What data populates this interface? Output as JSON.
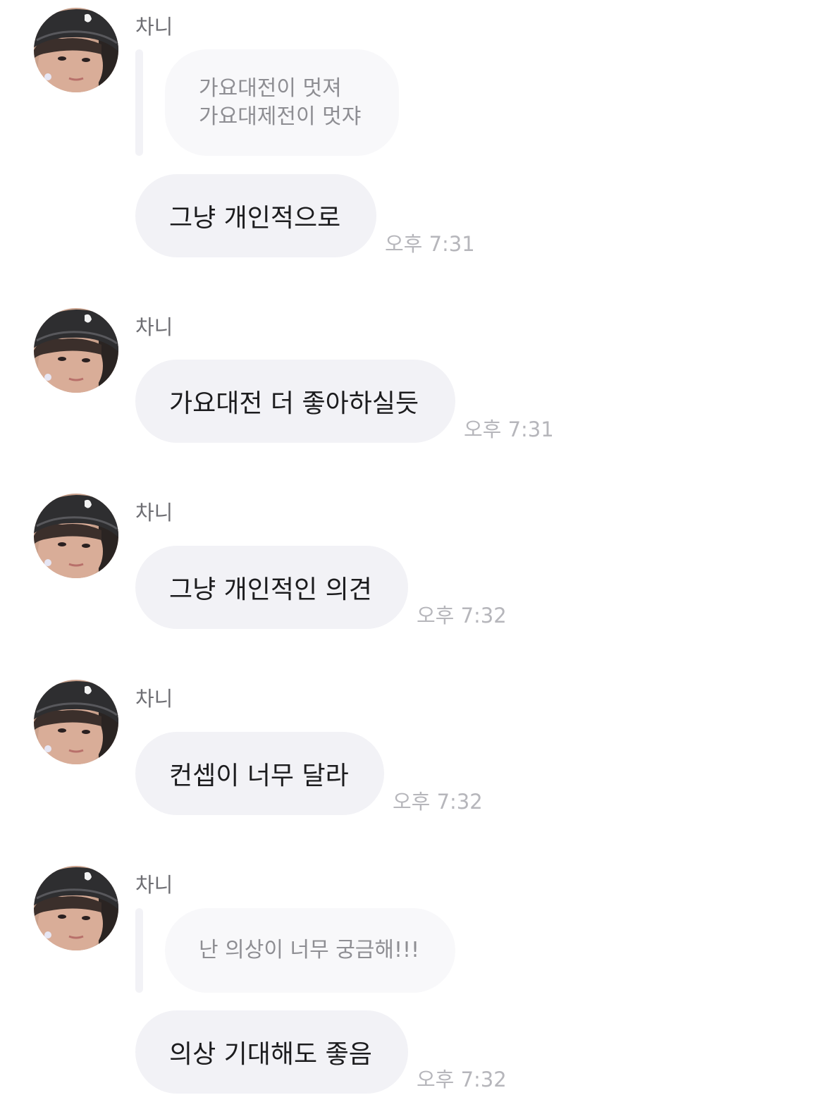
{
  "colors": {
    "bubble": "#f2f2f6",
    "reply_bubble": "#f8f8fa",
    "name_text": "#6e6e73",
    "time_text": "#b6b6bb"
  },
  "messages": [
    {
      "sender": "차니",
      "avatar_icon": "profile-photo-icon",
      "reply_quote": [
        "가요대전이 멋져",
        "가요대제전이 멋쟈"
      ],
      "text": "그냥 개인적으로",
      "time": "오후 7:31"
    },
    {
      "sender": "차니",
      "avatar_icon": "profile-photo-icon",
      "text": "가요대전 더 좋아하실듯",
      "time": "오후 7:31"
    },
    {
      "sender": "차니",
      "avatar_icon": "profile-photo-icon",
      "text": "그냥 개인적인 의견",
      "time": "오후 7:32"
    },
    {
      "sender": "차니",
      "avatar_icon": "profile-photo-icon",
      "text": "컨셉이 너무 달라",
      "time": "오후 7:32"
    },
    {
      "sender": "차니",
      "avatar_icon": "profile-photo-icon",
      "reply_quote": [
        "난 의상이 너무 궁금해!!!"
      ],
      "text": "의상 기대해도 좋음",
      "time": "오후 7:32"
    }
  ]
}
